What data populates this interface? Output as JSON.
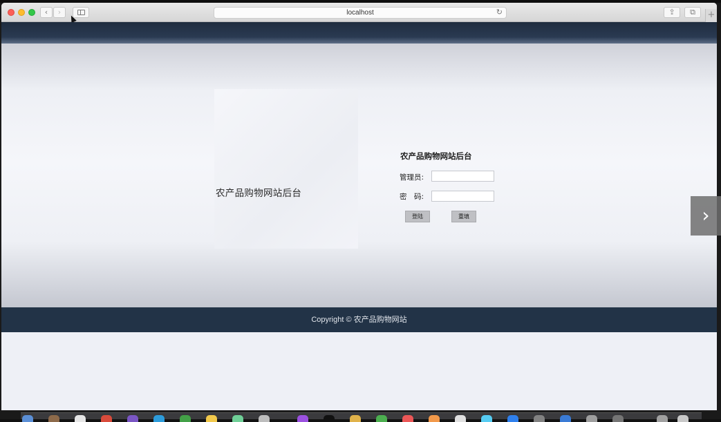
{
  "browser": {
    "address": "localhost",
    "back_glyph": "‹",
    "forward_glyph": "›",
    "reload_glyph": "↻",
    "share_glyph": "⇪",
    "tabs_glyph": "⧉",
    "newtab_glyph": "+"
  },
  "page": {
    "site_name": "农产品购物网站后台",
    "login": {
      "title": "农产品购物网站后台",
      "admin_label": "管理员:",
      "password_label": "密　码:",
      "admin_value": "",
      "password_value": "",
      "login_button": "登陆",
      "reset_button": "重填"
    },
    "footer": "Copyright © 农产品购物网站"
  },
  "overlay": {
    "next_glyph": "›"
  },
  "colors": {
    "header": "#1f2d3f",
    "footer": "#223347",
    "button": "#bfc0c4"
  }
}
